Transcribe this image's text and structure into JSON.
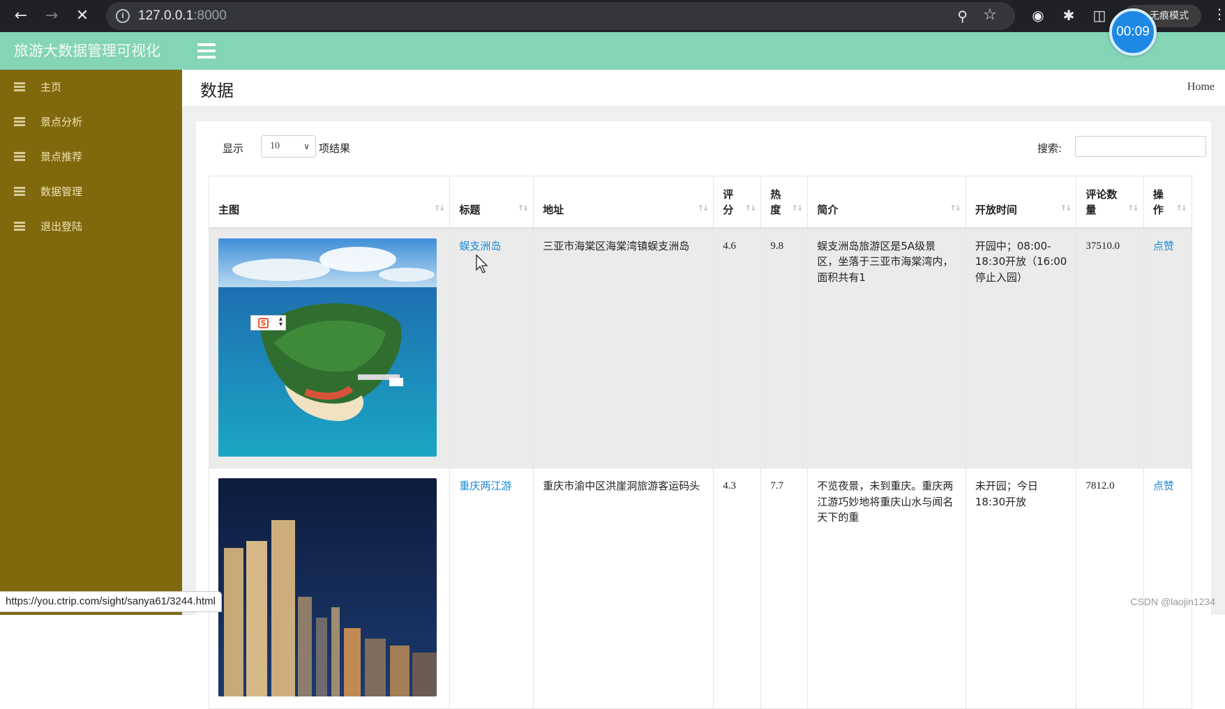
{
  "browser": {
    "url_host": "127.0.0.1",
    "url_port": ":8000",
    "incognito_label": "无痕模式",
    "timer": "00:09",
    "status_url": "https://you.ctrip.com/sight/sanya61/3244.html"
  },
  "app": {
    "brand": "旅游大数据管理可视化",
    "nav": [
      "主页",
      "景点分析",
      "景点推荐",
      "数据管理",
      "退出登陆"
    ],
    "page_title": "数据",
    "breadcrumb": "Home"
  },
  "table_controls": {
    "show_label": "显示",
    "page_length": "10",
    "results_label": "项结果",
    "search_label": "搜索:",
    "search_value": ""
  },
  "table": {
    "columns": [
      "主图",
      "标题",
      "地址",
      "评分",
      "热度",
      "简介",
      "开放时间",
      "评论数量",
      "操作"
    ],
    "rows": [
      {
        "title": "蜈支洲岛",
        "address": "三亚市海棠区海棠湾镇蜈支洲岛",
        "rating": "4.6",
        "heat": "9.8",
        "intro": "蜈支洲岛旅游区是5A级景区，坐落于三亚市海棠湾内，面积共有1",
        "hours": "开园中；08:00-18:30开放（16:00停止入园）",
        "comments": "37510.0",
        "action": "点赞"
      },
      {
        "title": "重庆两江游",
        "address": "重庆市渝中区洪崖洞旅游客运码头",
        "rating": "4.3",
        "heat": "7.7",
        "intro": "不览夜景，未到重庆。重庆两江游巧妙地将重庆山水与闻名天下的重",
        "hours": "未开园；今日18:30开放",
        "comments": "7812.0",
        "action": "点赞"
      }
    ]
  },
  "watermark": "CSDN @laojin1234",
  "colors": {
    "header": "#84d4b6",
    "sidebar": "#80680d",
    "link": "#1a8ad6",
    "timer": "#1e88e5"
  }
}
